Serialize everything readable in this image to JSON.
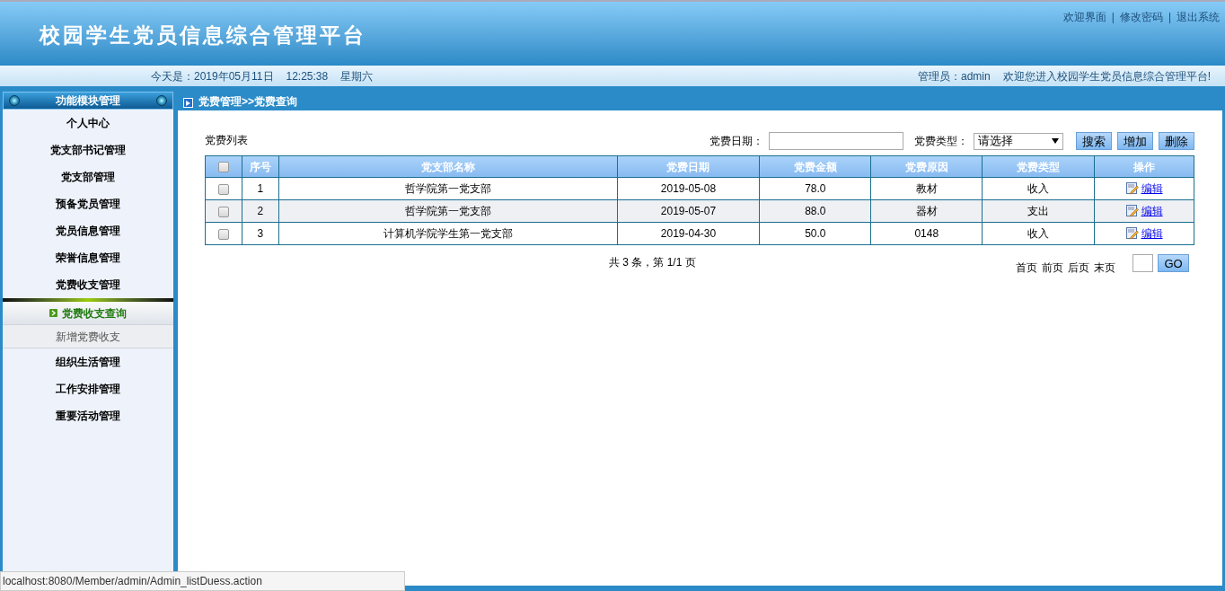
{
  "header": {
    "title": "校园学生党员信息综合管理平台",
    "links": [
      {
        "label": "欢迎界面"
      },
      {
        "label": "修改密码"
      },
      {
        "label": "退出系统"
      }
    ],
    "separators": [
      "|",
      "|"
    ]
  },
  "info_bar": {
    "date": "今天是：2019年05月11日",
    "time": "12:25:38",
    "weekday": "星期六",
    "admin": "管理员：admin",
    "welcome": "欢迎您进入校园学生党员信息综合管理平台!"
  },
  "sidebar": {
    "title": "功能模块管理",
    "items": [
      {
        "label": "个人中心"
      },
      {
        "label": "党支部书记管理"
      },
      {
        "label": "党支部管理"
      },
      {
        "label": "预备党员管理"
      },
      {
        "label": "党员信息管理"
      },
      {
        "label": "荣誉信息管理"
      },
      {
        "label": "党费收支管理",
        "children": [
          {
            "label": "党费收支查询",
            "selected": true
          },
          {
            "label": "新增党费收支",
            "selected": false
          }
        ]
      },
      {
        "label": "组织生活管理"
      },
      {
        "label": "工作安排管理"
      },
      {
        "label": "重要活动管理"
      }
    ]
  },
  "breadcrumb": "党费管理>>党费查询",
  "toolbar": {
    "list_title": "党费列表",
    "date_label": "党费日期：",
    "type_label": "党费类型：",
    "type_select": "请选择",
    "buttons": [
      "搜索",
      "增加",
      "删除"
    ]
  },
  "table": {
    "select_all_checked": false,
    "columns": [
      "序号",
      "党支部名称",
      "党费日期",
      "党费金额",
      "党费原因",
      "党费类型",
      "操作"
    ],
    "rows": [
      {
        "checked": false,
        "cells": [
          "1",
          "哲学院第一党支部",
          "2019-05-08",
          "78.0",
          "教材",
          "收入"
        ],
        "action": "编辑"
      },
      {
        "checked": false,
        "cells": [
          "2",
          "哲学院第一党支部",
          "2019-05-07",
          "88.0",
          "器材",
          "支出"
        ],
        "action": "编辑"
      },
      {
        "checked": false,
        "cells": [
          "3",
          "计算机学院学生第一党支部",
          "2019-04-30",
          "50.0",
          "0148",
          "收入"
        ],
        "action": "编辑"
      }
    ]
  },
  "pagination": {
    "summary": "共 3 条，第 1/1 页",
    "links": [
      "首页",
      "前页",
      "后页",
      "末页"
    ],
    "go": "GO"
  },
  "status_url": "localhost:8080/Member/admin/Admin_listDuess.action"
}
